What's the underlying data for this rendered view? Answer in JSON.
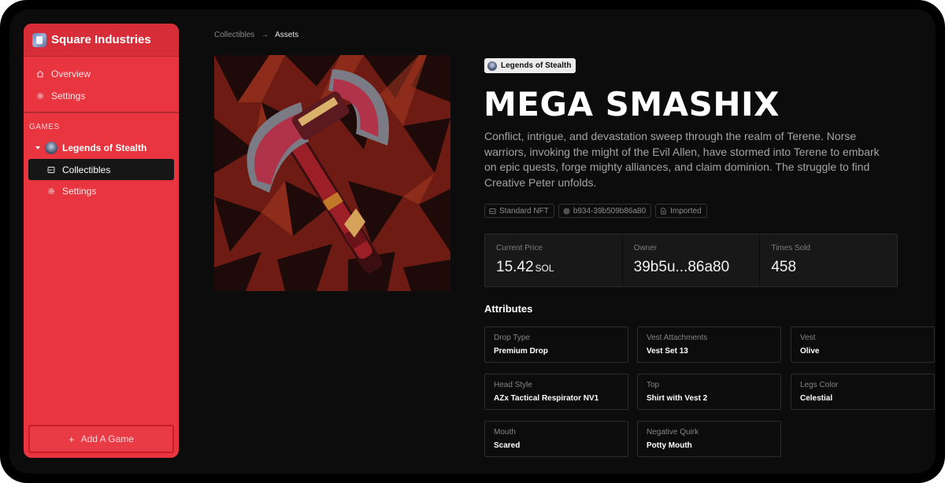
{
  "sidebar": {
    "brand": "Square Industries",
    "nav": [
      {
        "label": "Overview",
        "icon": "home-icon"
      },
      {
        "label": "Settings",
        "icon": "gear-icon"
      }
    ],
    "section_label": "GAMES",
    "game": {
      "label": "Legends of Stealth",
      "children": [
        {
          "label": "Collectibles",
          "icon": "nft-icon",
          "active": true
        },
        {
          "label": "Settings",
          "icon": "gear-icon",
          "active": false
        }
      ]
    },
    "add_button": "Add A Game"
  },
  "breadcrumb": {
    "items": [
      "Collectibles",
      "Assets"
    ],
    "separator": "→"
  },
  "asset": {
    "collection": "Legends of Stealth",
    "title": "MEGA SMASHIX",
    "description": "Conflict, intrigue, and devastation sweep through the realm of Terene. Norse warriors, invoking the might of the Evil Allen, have stormed into Terene to embark on epic quests, forge mighty alliances, and claim dominion. The struggle to find Creative Peter unfolds.",
    "tags": [
      {
        "label": "Standard NFT",
        "icon": "nft-icon"
      },
      {
        "label": "b934-39b509b86a80",
        "icon": "fingerprint-icon"
      },
      {
        "label": "Imported",
        "icon": "document-icon"
      }
    ],
    "stats": [
      {
        "label": "Current Price",
        "value": "15.42",
        "unit": "SOL"
      },
      {
        "label": "Owner",
        "value": "39b5u...86a80",
        "unit": ""
      },
      {
        "label": "Times Sold",
        "value": "458",
        "unit": ""
      }
    ]
  },
  "attributes": {
    "heading": "Attributes",
    "items": [
      {
        "label": "Drop Type",
        "value": "Premium Drop"
      },
      {
        "label": "Vest Attachments",
        "value": "Vest Set 13"
      },
      {
        "label": "Vest",
        "value": "Olive"
      },
      {
        "label": "Head Style",
        "value": "AZx Tactical Respirator NV1"
      },
      {
        "label": "Top",
        "value": "Shirt with Vest 2"
      },
      {
        "label": "Legs Color",
        "value": "Celestial"
      },
      {
        "label": "Mouth",
        "value": "Scared"
      },
      {
        "label": "Negative Quirk",
        "value": "Potty Mouth"
      }
    ]
  },
  "colors": {
    "sidebar_bg": "#e8353f",
    "active_item_bg": "#161616",
    "page_bg": "#0c0c0c"
  }
}
